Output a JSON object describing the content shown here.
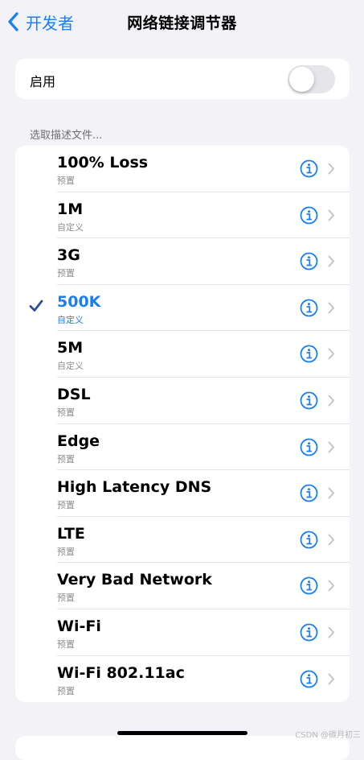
{
  "nav": {
    "back_label": "开发者",
    "title": "网络链接调节器"
  },
  "toggle": {
    "label": "启用",
    "on": false
  },
  "section_header": "选取描述文件...",
  "profiles": [
    {
      "title": "100% Loss",
      "subtitle": "预置",
      "selected": false
    },
    {
      "title": "1M",
      "subtitle": "自定义",
      "selected": false
    },
    {
      "title": "3G",
      "subtitle": "预置",
      "selected": false
    },
    {
      "title": "500K",
      "subtitle": "自定义",
      "selected": true
    },
    {
      "title": "5M",
      "subtitle": "自定义",
      "selected": false
    },
    {
      "title": "DSL",
      "subtitle": "预置",
      "selected": false
    },
    {
      "title": "Edge",
      "subtitle": "预置",
      "selected": false
    },
    {
      "title": "High Latency DNS",
      "subtitle": "预置",
      "selected": false
    },
    {
      "title": "LTE",
      "subtitle": "预置",
      "selected": false
    },
    {
      "title": "Very Bad Network",
      "subtitle": "预置",
      "selected": false
    },
    {
      "title": "Wi-Fi",
      "subtitle": "预置",
      "selected": false
    },
    {
      "title": "Wi-Fi 802.11ac",
      "subtitle": "预置",
      "selected": false
    }
  ],
  "icons": {
    "back": "chevron-left-icon",
    "check": "checkmark-icon",
    "info": "info-circle-icon",
    "chevron": "chevron-right-icon"
  },
  "colors": {
    "accent": "#1a7ff0",
    "check": "#2c4f9c",
    "background": "#f2f2f7",
    "secondary_text": "#8e8e93"
  },
  "watermark": "CSDN @碳月初三"
}
